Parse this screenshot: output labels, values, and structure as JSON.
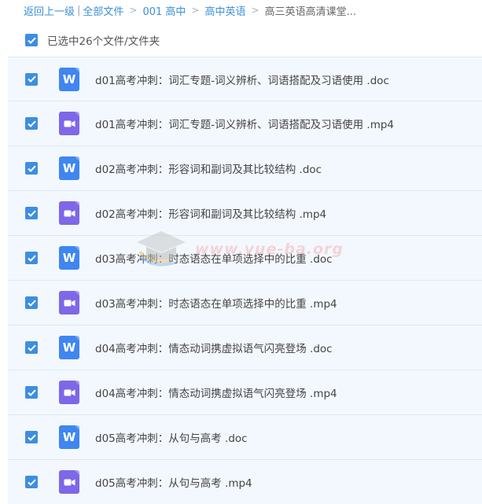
{
  "breadcrumb": {
    "back": "返回上一级",
    "all_files": "全部文件",
    "level1": "001 高中",
    "level2": "高中英语",
    "current": "高三英语高清课堂...",
    "sep": ">"
  },
  "selection": {
    "label": "已选中26个文件/文件夹",
    "checked": true
  },
  "files": [
    {
      "name": "d01高考冲刺：词汇专题-词义辨析、词语搭配及习语使用 .doc",
      "type": "doc",
      "checked": true
    },
    {
      "name": "d01高考冲刺：词汇专题-词义辨析、词语搭配及习语使用 .mp4",
      "type": "mp4",
      "checked": true
    },
    {
      "name": "d02高考冲刺：形容词和副词及其比较结构 .doc",
      "type": "doc",
      "checked": true
    },
    {
      "name": "d02高考冲刺：形容词和副词及其比较结构 .mp4",
      "type": "mp4",
      "checked": true
    },
    {
      "name": "d03高考冲刺：时态语态在单项选择中的比重 .doc",
      "type": "doc",
      "checked": true
    },
    {
      "name": "d03高考冲刺：时态语态在单项选择中的比重 .mp4",
      "type": "mp4",
      "checked": true
    },
    {
      "name": "d04高考冲刺：情态动词携虚拟语气闪亮登场 .doc",
      "type": "doc",
      "checked": true
    },
    {
      "name": "d04高考冲刺：情态动词携虚拟语气闪亮登场 .mp4",
      "type": "mp4",
      "checked": true
    },
    {
      "name": "d05高考冲刺：从句与高考 .doc",
      "type": "doc",
      "checked": true
    },
    {
      "name": "d05高考冲刺：从句与高考 .mp4",
      "type": "mp4",
      "checked": true
    }
  ],
  "icons": {
    "doc": {
      "name": "word-doc-icon",
      "glyph": "W",
      "color": "#3f86f0"
    },
    "mp4": {
      "name": "video-file-icon",
      "color": "#7e67e8"
    },
    "checkbox_color": "#3e8ee0"
  },
  "watermark": {
    "text": "www.yue-ba.org"
  }
}
